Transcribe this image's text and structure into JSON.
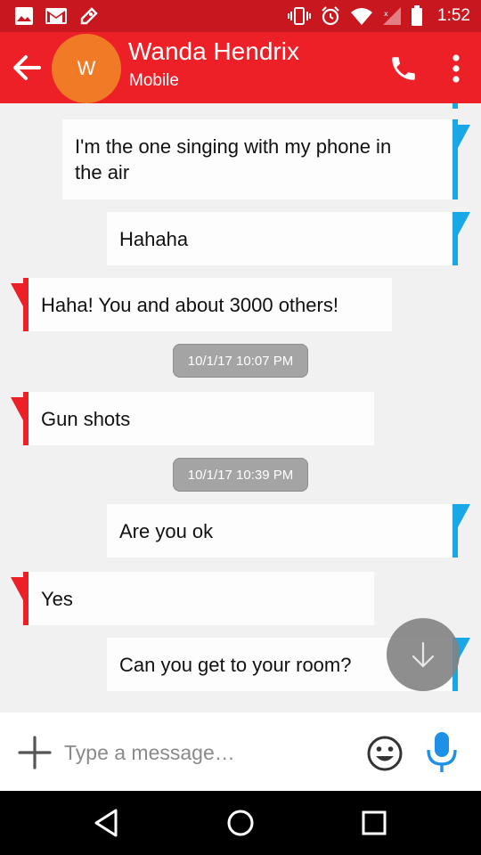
{
  "status_bar": {
    "time": "1:52"
  },
  "header": {
    "avatar_letter": "W",
    "contact_name": "Wanda Hendrix",
    "contact_subtitle": "Mobile"
  },
  "messages": [
    {
      "direction": "outgoing",
      "text_lines": [
        "I'm the one singing with my phone in",
        "the air"
      ]
    },
    {
      "direction": "outgoing",
      "text": "Hahaha"
    },
    {
      "direction": "incoming",
      "text": "Haha! You and about 3000 others!"
    },
    {
      "direction": "timestamp",
      "text": "10/1/17 10:07 PM"
    },
    {
      "direction": "incoming",
      "text": "Gun shots"
    },
    {
      "direction": "timestamp",
      "text": "10/1/17 10:39 PM"
    },
    {
      "direction": "outgoing",
      "text": "Are you ok"
    },
    {
      "direction": "incoming",
      "text": "Yes"
    },
    {
      "direction": "outgoing",
      "text": "Can you get to your room?"
    }
  ],
  "composer": {
    "placeholder": "Type a message…",
    "value": ""
  },
  "colors": {
    "header": "#ee2027",
    "status_bar": "#c8171f",
    "avatar": "#f07a26",
    "outgoing_accent": "#1aa7e6",
    "incoming_accent": "#ee2027",
    "mic": "#1e90e6"
  },
  "icons": {
    "status_left": [
      "image-icon",
      "gmail-icon",
      "photo-edit-icon"
    ],
    "status_right": [
      "vibrate-icon",
      "alarm-icon",
      "wifi-icon",
      "cell-signal-icon",
      "battery-icon"
    ],
    "header": [
      "back-arrow-icon",
      "phone-icon",
      "more-vert-icon"
    ],
    "composer": [
      "add-icon",
      "emoji-icon",
      "mic-icon"
    ],
    "nav": [
      "back-triangle-icon",
      "home-circle-icon",
      "recents-square-icon"
    ],
    "fab": "arrow-down-icon"
  }
}
